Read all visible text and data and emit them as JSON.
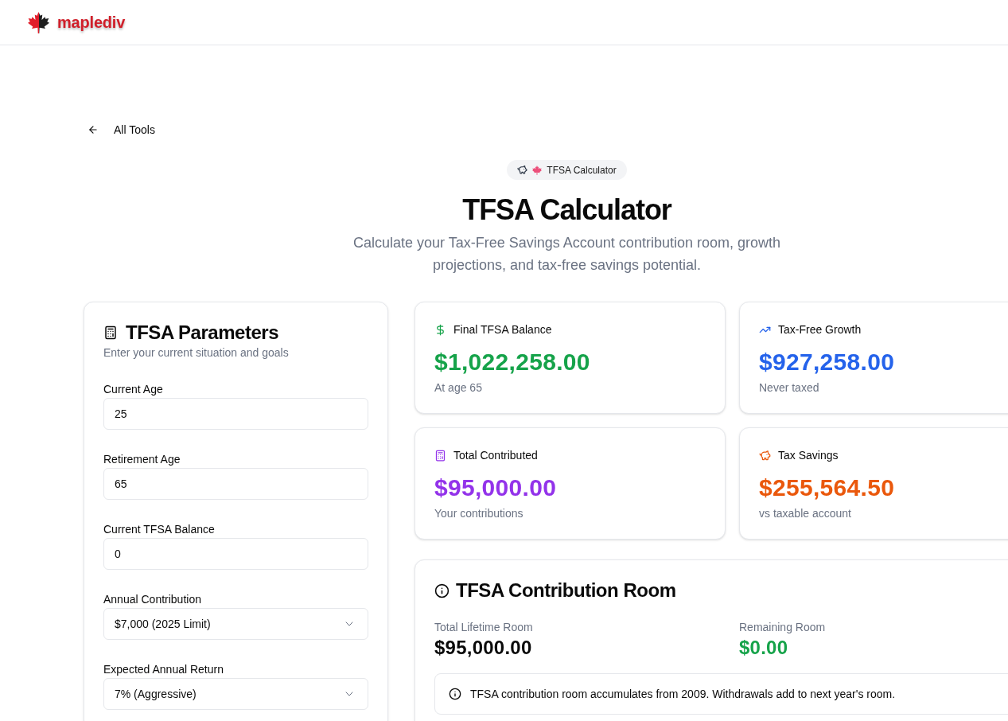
{
  "header": {
    "logo_text": "maplediv"
  },
  "back_link": {
    "label": "All Tools"
  },
  "badge": {
    "label": "TFSA Calculator"
  },
  "title": "TFSA Calculator",
  "subtitle": "Calculate your Tax-Free Savings Account contribution room, growth projections, and tax-free savings potential.",
  "parameters": {
    "title": "TFSA Parameters",
    "subtitle": "Enter your current situation and goals",
    "fields": [
      {
        "kind": "input",
        "label": "Current Age",
        "value": "25"
      },
      {
        "kind": "input",
        "label": "Retirement Age",
        "value": "65"
      },
      {
        "kind": "input",
        "label": "Current TFSA Balance",
        "value": "0"
      },
      {
        "kind": "select",
        "label": "Annual Contribution",
        "value": "$7,000 (2025 Limit)"
      },
      {
        "kind": "select",
        "label": "Expected Annual Return",
        "value": "7% (Aggressive)"
      }
    ]
  },
  "stats": [
    {
      "label": "Final TFSA Balance",
      "value": "$1,022,258.00",
      "note": "At age 65",
      "color": "#16a34a"
    },
    {
      "label": "Tax-Free Growth",
      "value": "$927,258.00",
      "note": "Never taxed",
      "color": "#2563eb"
    },
    {
      "label": "Total Contributed",
      "value": "$95,000.00",
      "note": "Your contributions",
      "color": "#9333ea"
    },
    {
      "label": "Tax Savings",
      "value": "$255,564.50",
      "note": "vs taxable account",
      "color": "#ea580c"
    }
  ],
  "contribution_room": {
    "title": "TFSA Contribution Room",
    "items": [
      {
        "label": "Total Lifetime Room",
        "value": "$95,000.00",
        "color": "#0a0a0a"
      },
      {
        "label": "Remaining Room",
        "value": "$0.00",
        "color": "#16a34a"
      }
    ],
    "note": "TFSA contribution room accumulates from 2009. Withdrawals add to next year's room."
  }
}
